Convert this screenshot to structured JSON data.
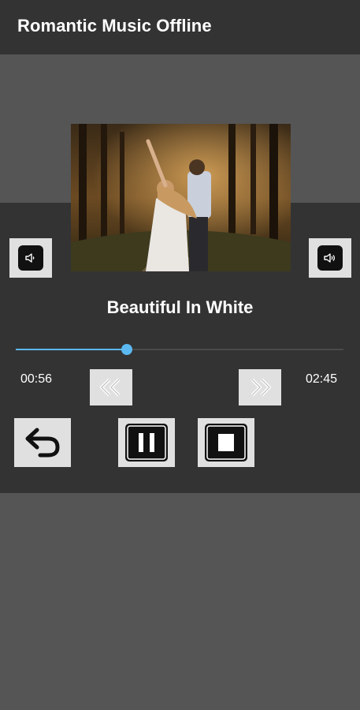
{
  "app": {
    "title": "Romantic Music Offline"
  },
  "player": {
    "song_title": "Beautiful In White",
    "elapsed": "00:56",
    "duration": "02:45",
    "progress_fraction": 0.34
  },
  "icons": {
    "volume_down": "volume-down-icon",
    "volume_up": "volume-up-icon",
    "rewind": "rewind-icon",
    "fast_forward": "fast-forward-icon",
    "back": "back-arrow-icon",
    "pause": "pause-icon",
    "stop": "stop-icon"
  },
  "colors": {
    "appbar_bg": "#333333",
    "page_bg": "#555555",
    "accent": "#5cb8f0",
    "button_bg": "#e0e0e0"
  }
}
